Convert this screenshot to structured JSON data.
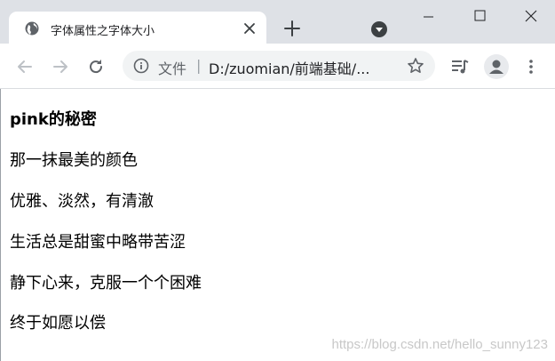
{
  "browser": {
    "tab": {
      "title": "字体属性之字体大小",
      "favicon": "globe-icon",
      "close_icon": "close-icon"
    },
    "new_tab_icon": "plus-icon",
    "tab_search_icon": "chevron-down-icon",
    "window_controls": [
      "minimize-icon",
      "maximize-icon",
      "close-icon"
    ],
    "toolbar": {
      "back_icon": "arrow-left-icon",
      "forward_icon": "arrow-right-icon",
      "reload_icon": "reload-icon",
      "omnibox": {
        "info_icon": "info-icon",
        "scheme_label": "文件",
        "separator": "|",
        "url": "D:/zuomian/前端基础/...",
        "bookmark_icon": "star-icon"
      },
      "media_icon": "media-control-icon",
      "profile_icon": "avatar-icon",
      "menu_icon": "kebab-menu-icon"
    },
    "colors": {
      "tabstrip": "#dee1e6",
      "omnibox": "#f1f3f4",
      "icon": "#5f6368"
    }
  },
  "page": {
    "heading": "pink的秘密",
    "lines": [
      "那一抹最美的颜色",
      "优雅、淡然，有清澈",
      "生活总是甜蜜中略带苦涩",
      "静下心来，克服一个个困难",
      "终于如愿以偿"
    ]
  },
  "watermark": "https://blog.csdn.net/hello_sunny123"
}
